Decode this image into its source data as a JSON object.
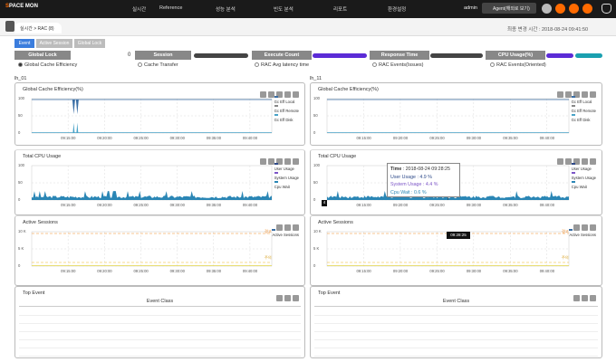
{
  "logo": {
    "a": "S",
    "b": "PACE MON"
  },
  "nav": [
    "실시간",
    "Reference",
    "성능 분석",
    "빈도 분석",
    "리포트",
    "환경설정"
  ],
  "user": "admin",
  "agent_button": "Agent(해외로 보기)",
  "subheader": {
    "tab": "실시간 > RAC (8)",
    "last_updated": "최종 변경 시간 : 2018-08-24 09:41:50"
  },
  "category_tabs": [
    "Event",
    "Active Session",
    "Global Lock"
  ],
  "metrics": [
    {
      "label": "Global Lock",
      "value": "0"
    },
    {
      "label": "Session",
      "value": ""
    },
    {
      "label": "Execute Count",
      "value": ""
    },
    {
      "label": "Response Time",
      "value": ""
    },
    {
      "label": "CPU Usage(%)",
      "value": ""
    }
  ],
  "radios": [
    "Global Cache Efficiency",
    "Cache Transfer",
    "RAC Avg latency time",
    "RAC Events(Issues)",
    "RAC Events(Oriented)"
  ],
  "instances": [
    {
      "name": "lh_01",
      "gce_title": "Global Cache Efficiency(%)",
      "cpu_title": "Total CPU Usage",
      "as_title": "Active Sessions",
      "te_title": "Top Event",
      "event_class": "Event Class"
    },
    {
      "name": "lh_11",
      "gce_title": "Global Cache Efficiency(%)",
      "cpu_title": "Total CPU Usage",
      "as_title": "Active Sessions",
      "te_title": "Top Event",
      "event_class": "Event Class"
    }
  ],
  "gce_legend": [
    "Gc Eff Local",
    "Gc Eff Remote",
    "Gc Eff Disk"
  ],
  "cpu_legend": [
    "User Usage",
    "System Usage",
    "Cpu Wait"
  ],
  "as_legend": [
    "Active Sessions"
  ],
  "gce_y": [
    "100",
    "50",
    "0"
  ],
  "cpu_y": [
    "100",
    "50",
    "0"
  ],
  "as_y": [
    "10 K",
    "5 K",
    "0"
  ],
  "x_ticks": [
    "09:15:00",
    "09:20:00",
    "09:25:00",
    "09:30:00",
    "09:35:00",
    "09:40:00"
  ],
  "as_marks": {
    "top": "경고",
    "bottom": "주의"
  },
  "cpu_marker": "4",
  "tooltip": {
    "time_label": "Time",
    "time": "2018-08-24 09:28:25",
    "user": "User Usage : 4.9 %",
    "system": "System Usage : 4.4 %",
    "wait": "Cpu Wait : 0.6 %",
    "axis_time": "09:28:25"
  },
  "colors": {
    "user": "#2f4b8a",
    "system": "#7c55c7",
    "wait": "#2a86b5",
    "local": "#3a6ea5",
    "remote": "#888",
    "disk": "#4aa3c8"
  }
}
